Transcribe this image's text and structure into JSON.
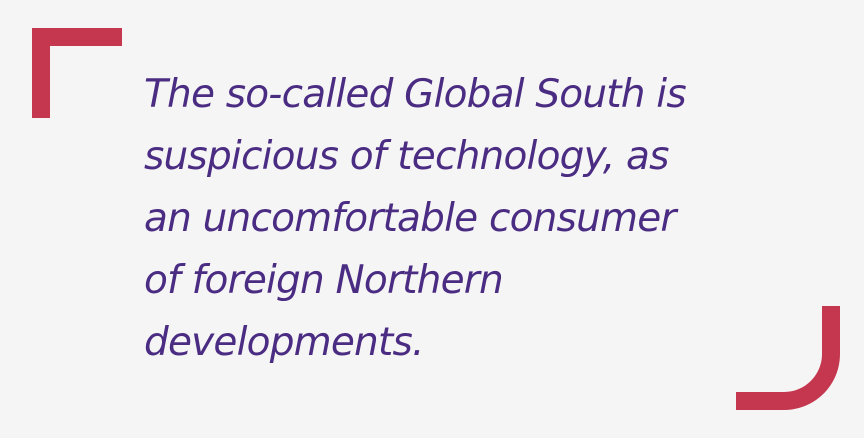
{
  "quote": {
    "lines": [
      "The so-called Global South is",
      "suspicious of technology, as",
      "an uncomfortable consumer",
      "of foreign Northern",
      "developments."
    ]
  },
  "decorations": {
    "top_left_icon": "corner-bracket-icon",
    "bottom_right_icon": "rounded-corner-bracket-icon"
  },
  "colors": {
    "background": "#f5f5f5",
    "accent": "#c4374f",
    "text": "#4b2c83"
  }
}
